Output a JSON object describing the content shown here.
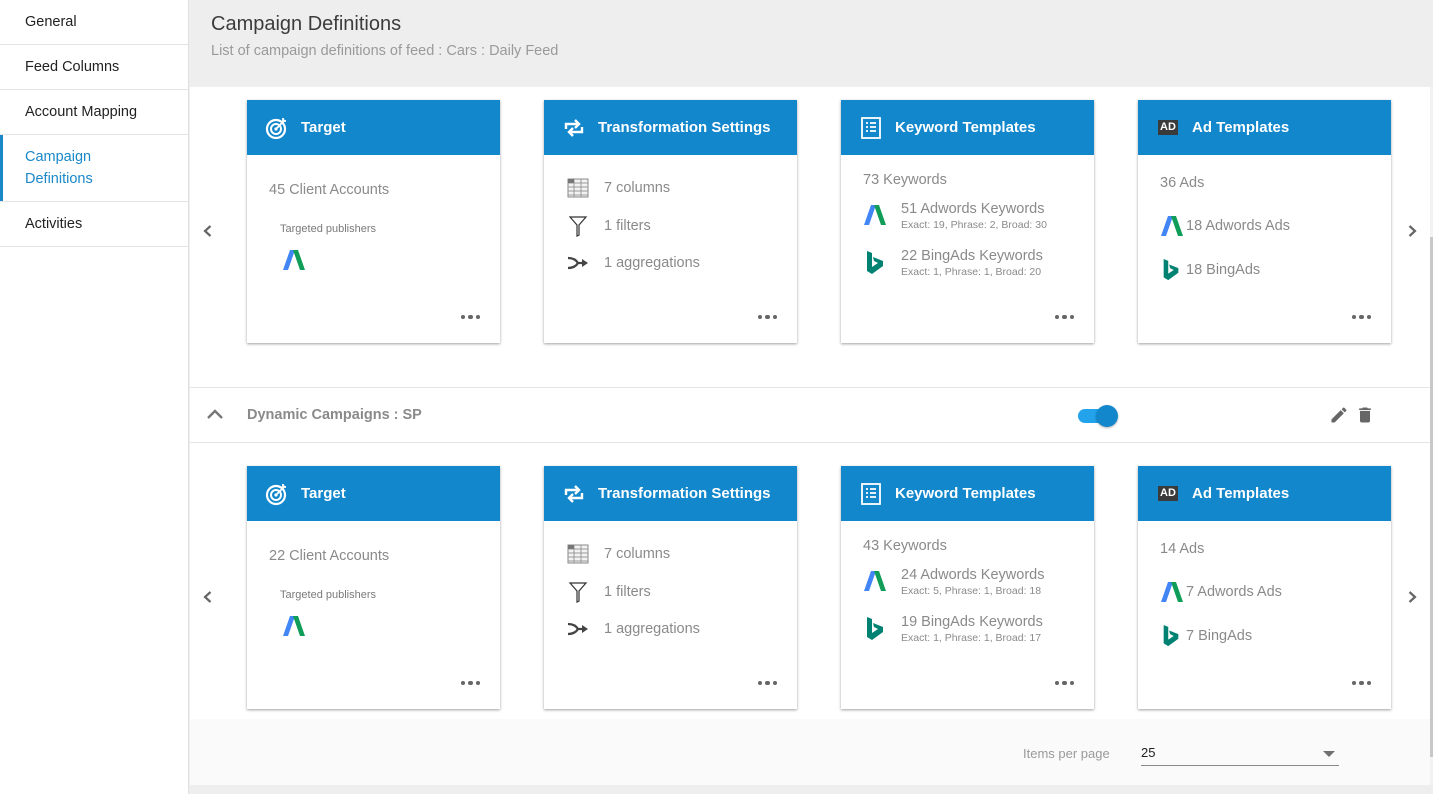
{
  "sidebar": {
    "items": [
      {
        "label": "General",
        "active": false
      },
      {
        "label": "Feed Columns",
        "active": false
      },
      {
        "label": "Account Mapping",
        "active": false
      },
      {
        "label": "Campaign Definitions",
        "active": true
      },
      {
        "label": "Activities",
        "active": false
      }
    ]
  },
  "header": {
    "title": "Campaign Definitions",
    "subtitle": "List of campaign definitions of feed : Cars : Daily Feed"
  },
  "colors": {
    "accent": "#1287cc",
    "active_nav": "#1a88c9",
    "adwords_blue": "#4285f4",
    "adwords_green": "#0f9d58",
    "bing_teal": "#008272"
  },
  "groups": [
    {
      "title": "",
      "cards": {
        "target": {
          "title": "Target",
          "client_accounts": "45 Client Accounts",
          "publishers_label": "Targeted publishers"
        },
        "transformation": {
          "title": "Transformation Settings",
          "columns": "7 columns",
          "filters": "1 filters",
          "aggregations": "1 aggregations"
        },
        "keywords": {
          "title": "Keyword Templates",
          "total": "73 Keywords",
          "adwords": "51 Adwords Keywords",
          "adwords_detail": "Exact: 19, Phrase: 2, Broad: 30",
          "bing": "22 BingAds Keywords",
          "bing_detail": "Exact: 1, Phrase: 1, Broad: 20"
        },
        "ads": {
          "title": "Ad Templates",
          "icon_text": "AD",
          "total": "36 Ads",
          "adwords": "18 Adwords Ads",
          "bing": "18 BingAds"
        }
      }
    },
    {
      "title": "Dynamic Campaigns : SP",
      "enabled": true,
      "cards": {
        "target": {
          "title": "Target",
          "client_accounts": "22 Client Accounts",
          "publishers_label": "Targeted publishers"
        },
        "transformation": {
          "title": "Transformation Settings",
          "columns": "7 columns",
          "filters": "1 filters",
          "aggregations": "1 aggregations"
        },
        "keywords": {
          "title": "Keyword Templates",
          "total": "43 Keywords",
          "adwords": "24 Adwords Keywords",
          "adwords_detail": "Exact: 5, Phrase: 1, Broad: 18",
          "bing": "19 BingAds Keywords",
          "bing_detail": "Exact: 1, Phrase: 1, Broad: 17"
        },
        "ads": {
          "title": "Ad Templates",
          "icon_text": "AD",
          "total": "14 Ads",
          "adwords": "7 Adwords Ads",
          "bing": "7 BingAds"
        }
      }
    }
  ],
  "pagination": {
    "items_per_page_label": "Items per page",
    "items_per_page_value": "25"
  }
}
